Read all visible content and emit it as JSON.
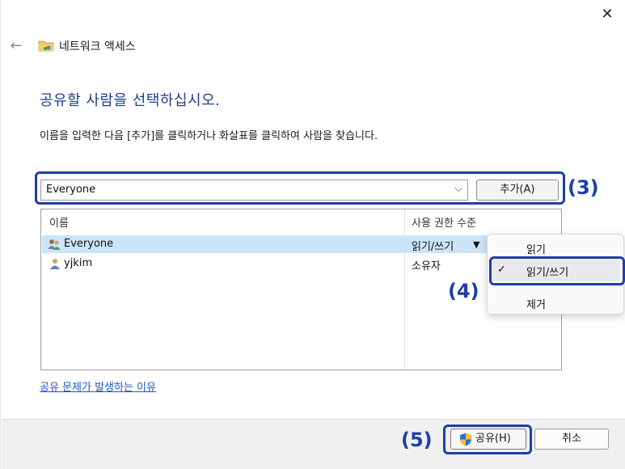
{
  "window": {
    "title": "네트워크 액세스",
    "close_label": "✕",
    "back_label": "←"
  },
  "main": {
    "heading": "공유할 사람을 선택하십시오.",
    "instruction": "이름을 입력한 다음 [추가]를 클릭하거나 화살표를 클릭하여 사람을 찾습니다.",
    "name_input_value": "Everyone",
    "add_button_label": "추가(A)",
    "table": {
      "headers": [
        "이름",
        "사용 권한 수준"
      ],
      "rows": [
        {
          "name": "Everyone",
          "permission": "읽기/쓰기"
        },
        {
          "name": "yjkim",
          "permission": "소유자"
        }
      ]
    },
    "help_link": "공유 문제가 발생하는 이유"
  },
  "permission_menu": {
    "items": [
      "읽기",
      "읽기/쓰기",
      "제거"
    ],
    "selected": "읽기/쓰기"
  },
  "footer": {
    "share_button_label": "공유(H)",
    "cancel_button_label": "취소"
  },
  "annotations": {
    "a3": "(3)",
    "a4": "(4)",
    "a5": "(5)"
  },
  "colors": {
    "accent": "#1f3fa6",
    "heading": "#1d3f8a",
    "selection": "#cce4f7",
    "link": "#1a5bbf"
  }
}
